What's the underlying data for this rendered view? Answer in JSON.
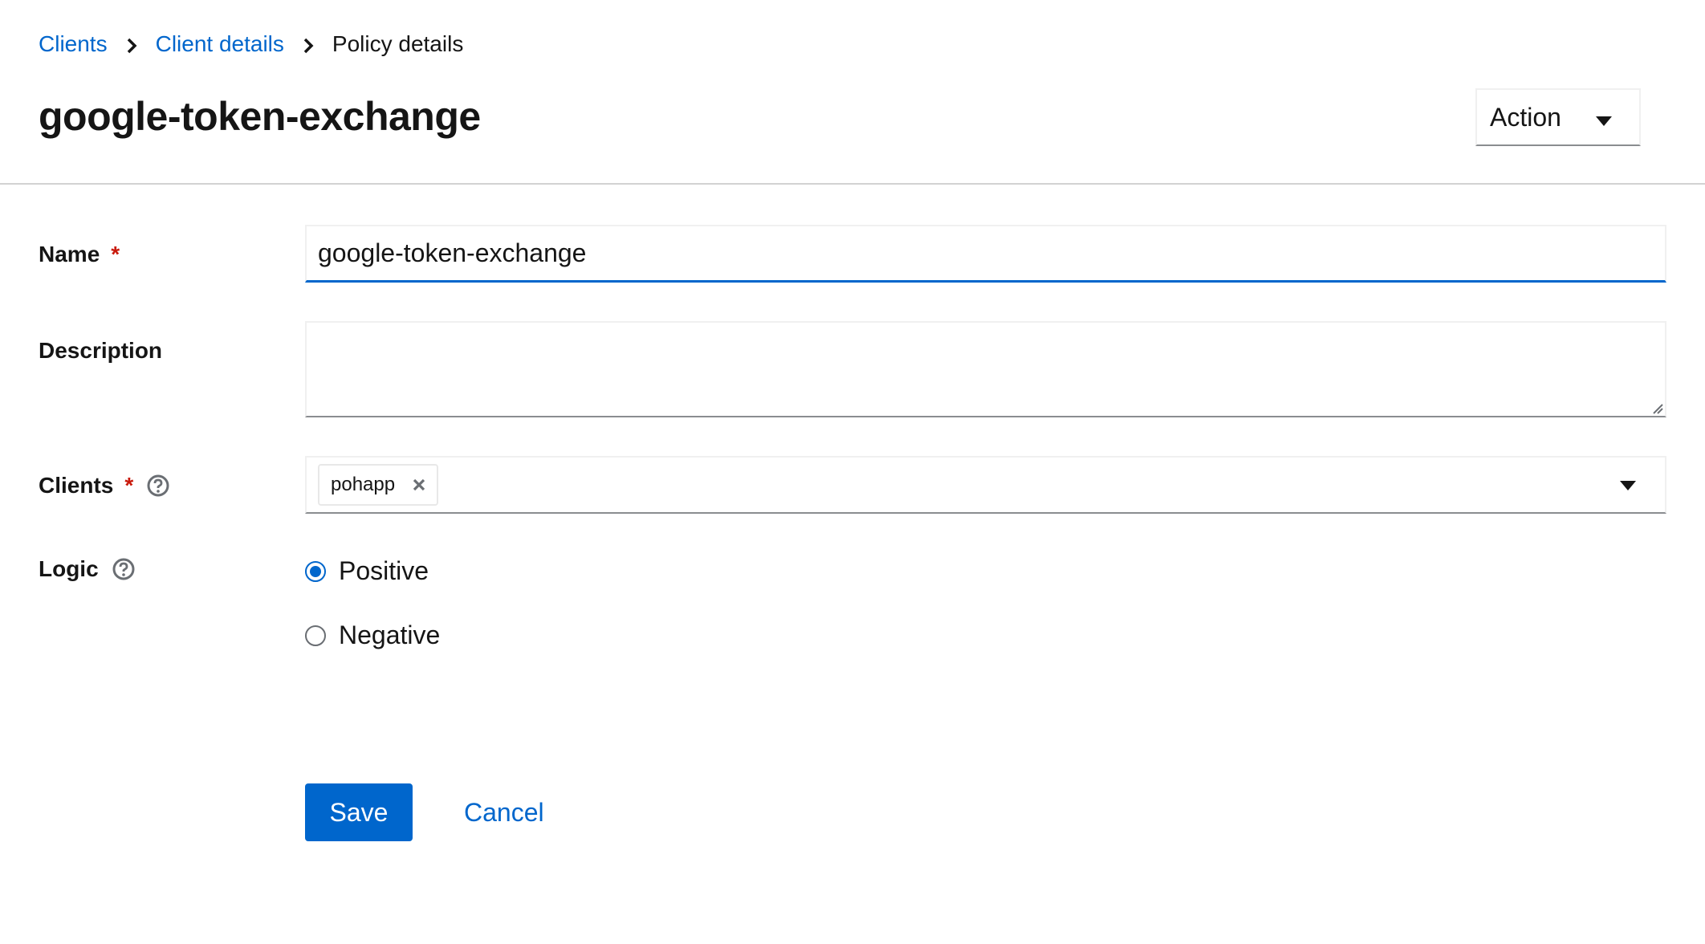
{
  "breadcrumb": {
    "items": [
      "Clients",
      "Client details"
    ],
    "current": "Policy details"
  },
  "header": {
    "title": "google-token-exchange",
    "action_label": "Action"
  },
  "form": {
    "name": {
      "label": "Name",
      "required_mark": "*",
      "value": "google-token-exchange"
    },
    "description": {
      "label": "Description",
      "value": ""
    },
    "clients": {
      "label": "Clients",
      "required_mark": "*",
      "chips": [
        "pohapp"
      ]
    },
    "logic": {
      "label": "Logic",
      "options": [
        {
          "label": "Positive",
          "selected": true
        },
        {
          "label": "Negative",
          "selected": false
        }
      ]
    }
  },
  "buttons": {
    "save_label": "Save",
    "cancel_label": "Cancel"
  },
  "colors": {
    "link": "#0066cc",
    "primary": "#0066cc",
    "required": "#c9190b"
  },
  "icons": [
    "chevron-right-icon",
    "caret-down-icon",
    "help-icon",
    "close-icon"
  ]
}
